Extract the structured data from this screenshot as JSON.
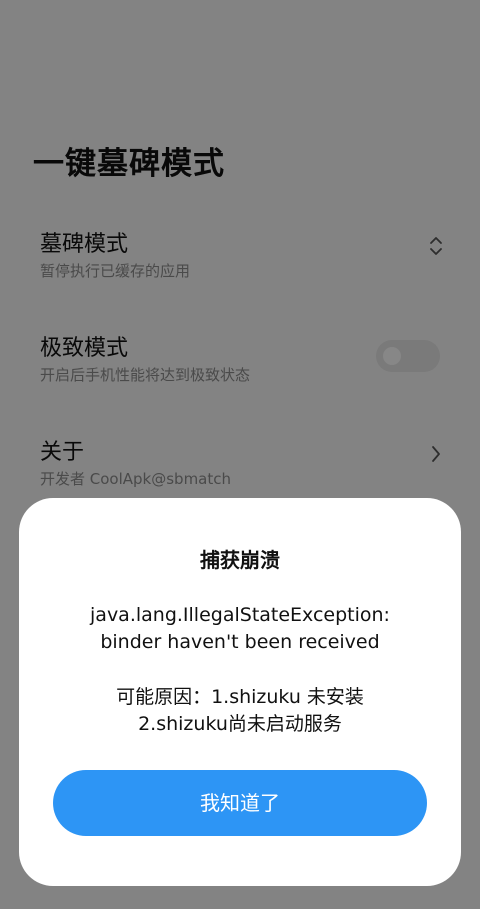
{
  "page": {
    "title": "一键墓碑模式"
  },
  "settings": [
    {
      "title": "墓碑模式",
      "subtitle": "暂停执行已缓存的应用",
      "control": "updown-icon"
    },
    {
      "title": "极致模式",
      "subtitle": "开启后手机性能将达到极致状态",
      "control": "toggle",
      "toggle_on": false
    },
    {
      "title": "关于",
      "subtitle": "开发者 CoolApk@sbmatch",
      "control": "chevron-right-icon"
    }
  ],
  "dialog": {
    "title": "捕获崩溃",
    "error_line1": "java.lang.IllegalStateException:",
    "error_line2": "binder haven't been received",
    "reason_line1": "可能原因：1.shizuku 未安装",
    "reason_line2": "2.shizuku尚未启动服务",
    "confirm_label": "我知道了"
  },
  "colors": {
    "accent": "#2d95f5",
    "scrim": "rgba(0,0,0,0.47)"
  }
}
